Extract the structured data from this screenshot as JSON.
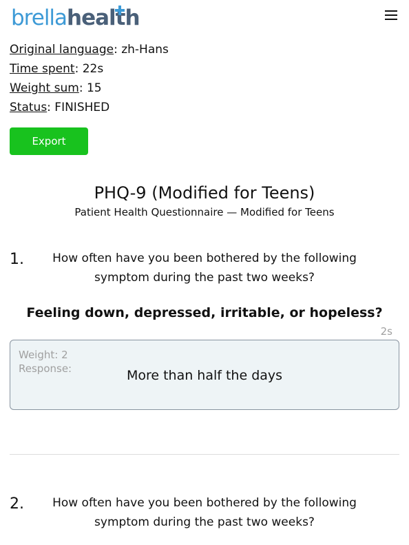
{
  "header": {
    "logo_part1": "brella",
    "logo_part2": "health",
    "menu_icon": "hamburger-menu-icon"
  },
  "meta": {
    "original_language": {
      "label": "Original language",
      "value": ": zh-Hans"
    },
    "time_spent": {
      "label": "Time spent",
      "value": ": 22s"
    },
    "weight_sum": {
      "label": "Weight sum",
      "value": ": 15"
    },
    "status": {
      "label": "Status",
      "value": ": FINISHED"
    }
  },
  "export_label": "Export",
  "questionnaire": {
    "title": "PHQ-9 (Modified for Teens)",
    "subtitle": "Patient Health Questionnaire — Modified for Teens"
  },
  "questions": [
    {
      "number": "1.",
      "line1": "How often have you been bothered by the following",
      "line2": "symptom during the past two weeks?",
      "symptom": "Feeling down, depressed, irritable, or hopeless?",
      "time": "2s",
      "weight": "Weight: 2",
      "response_label": "Response:",
      "answer": "More than half the days"
    },
    {
      "number": "2.",
      "line1": "How often have you been bothered by the following",
      "line2": "symptom during the past two weeks?"
    }
  ],
  "colors": {
    "brand_blue": "#3d9ad6",
    "brand_dark": "#4a6079",
    "export_green": "#18c21e",
    "response_bg": "#eef4f6"
  }
}
